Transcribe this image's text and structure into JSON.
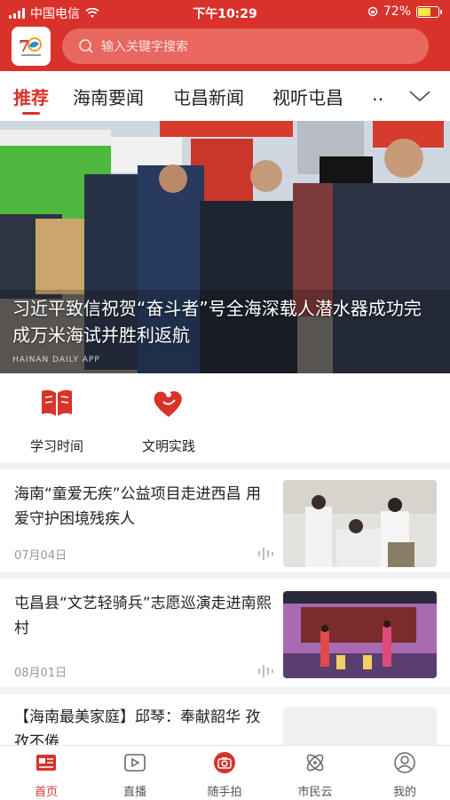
{
  "status_bar": {
    "carrier": "中国电信",
    "time": "下午10:29",
    "battery": "72%",
    "battery_level": 0.72
  },
  "search": {
    "placeholder": "输入关键字搜索"
  },
  "tabs": [
    {
      "label": "推荐",
      "active": true
    },
    {
      "label": "海南要闻"
    },
    {
      "label": "屯昌新闻"
    },
    {
      "label": "视听屯昌"
    },
    {
      "label": "…"
    }
  ],
  "banner": {
    "title": "习近平致信祝贺“奋斗者”号全海深载人潜水器成功完成万米海试并胜利返航",
    "watermark": "HAINAN DAILY APP"
  },
  "quick_links": [
    {
      "label": "学习时间",
      "icon": "book-icon"
    },
    {
      "label": "文明实践",
      "icon": "heart-icon"
    }
  ],
  "news": [
    {
      "title": "海南“童爱无疾”公益项目走进西昌 用爱守护困境残疾人",
      "date": "07月04日"
    },
    {
      "title": "屯昌县“文艺轻骑兵”志愿巡演走进南熙村",
      "date": "08月01日"
    },
    {
      "title": "【海南最美家庭】邱琴：奉献韶华 孜孜不倦",
      "date": ""
    }
  ],
  "bottom_nav": [
    {
      "label": "首页",
      "icon": "news-icon",
      "active": true
    },
    {
      "label": "直播",
      "icon": "play-icon"
    },
    {
      "label": "随手拍",
      "icon": "camera-icon"
    },
    {
      "label": "市民云",
      "icon": "atom-icon"
    },
    {
      "label": "我的",
      "icon": "user-icon"
    }
  ],
  "colors": {
    "brand": "#d9322a",
    "text": "#222222",
    "muted": "#999999"
  }
}
